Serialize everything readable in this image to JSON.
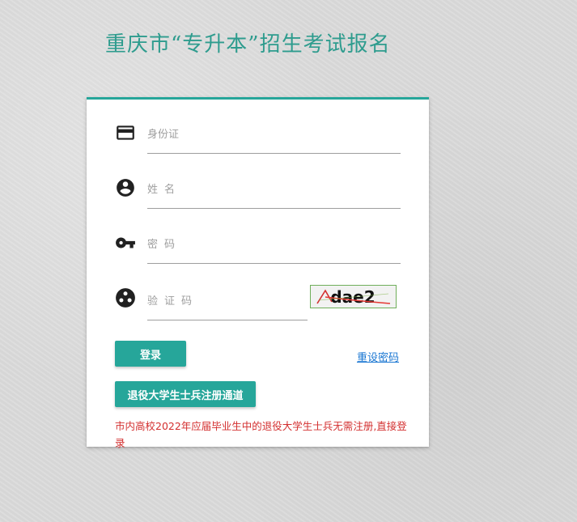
{
  "page": {
    "title": "重庆市“专升本”招生考试报名"
  },
  "form": {
    "id_card": {
      "placeholder": "身份证",
      "icon": "id-card-icon"
    },
    "name": {
      "placeholder": "姓名",
      "icon": "account-circle-icon"
    },
    "password": {
      "placeholder": "密码",
      "icon": "key-icon"
    },
    "captcha": {
      "placeholder": "验证码",
      "icon": "captcha-icon",
      "image_text": "dae2"
    }
  },
  "actions": {
    "login_label": "登录",
    "reset_password_label": "重设密码",
    "veteran_register_label": "退役大学生士兵注册通道"
  },
  "notice": {
    "text": "市内高校2022年应届毕业生中的退役大学生士兵无需注册,直接登录"
  },
  "colors": {
    "accent": "#26a69a",
    "title": "#2e9c8e",
    "notice": "#d32f2f",
    "link": "#1976d2"
  }
}
